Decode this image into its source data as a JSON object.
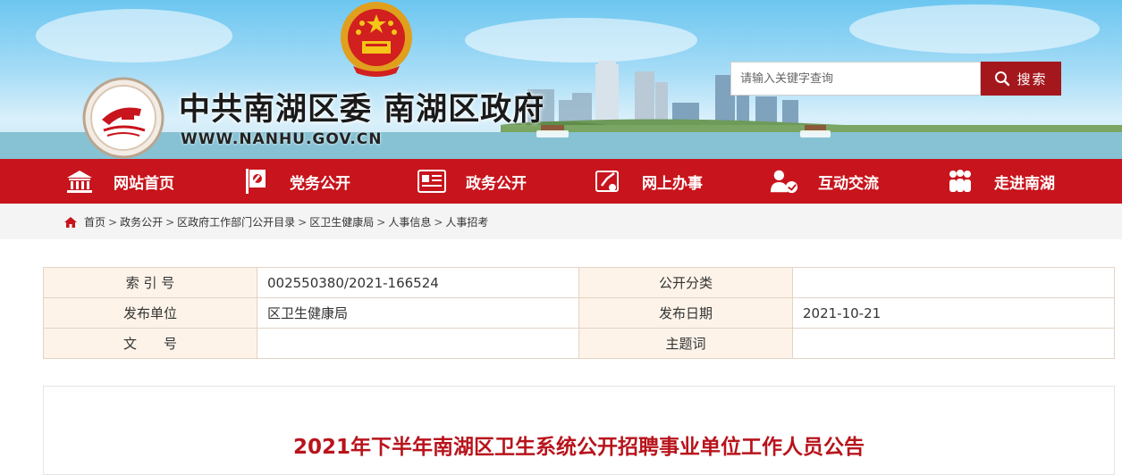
{
  "header": {
    "site_title": "中共南湖区委 南湖区政府",
    "site_url": "WWW.NANHU.GOV.CN"
  },
  "search": {
    "placeholder": "请输入关键字查询",
    "button_label": "搜索"
  },
  "nav": {
    "items": [
      {
        "label": "网站首页",
        "icon": "home-building-icon"
      },
      {
        "label": "党务公开",
        "icon": "party-flag-icon"
      },
      {
        "label": "政务公开",
        "icon": "document-list-icon"
      },
      {
        "label": "网上办事",
        "icon": "online-service-icon"
      },
      {
        "label": "互动交流",
        "icon": "user-chat-icon"
      },
      {
        "label": "走进南湖",
        "icon": "people-group-icon"
      }
    ]
  },
  "breadcrumb": {
    "items": [
      "首页",
      "政务公开",
      "区政府工作部门公开目录",
      "区卫生健康局",
      "人事信息",
      "人事招考"
    ],
    "separator": ">"
  },
  "meta": {
    "rows": [
      {
        "k1": "索 引 号",
        "v1": "002550380/2021-166524",
        "k2": "公开分类",
        "v2": ""
      },
      {
        "k1": "发布单位",
        "v1": "区卫生健康局",
        "k2": "发布日期",
        "v2": "2021-10-21"
      },
      {
        "k1": "文　　号",
        "v1": "",
        "k2": "主题词",
        "v2": ""
      }
    ]
  },
  "article": {
    "title": "2021年下半年南湖区卫生系统公开招聘事业单位工作人员公告"
  },
  "colors": {
    "nav_red": "#c8141c",
    "search_button": "#a4171d",
    "title_red": "#b8141c",
    "meta_key_bg": "#fdf3e9"
  }
}
